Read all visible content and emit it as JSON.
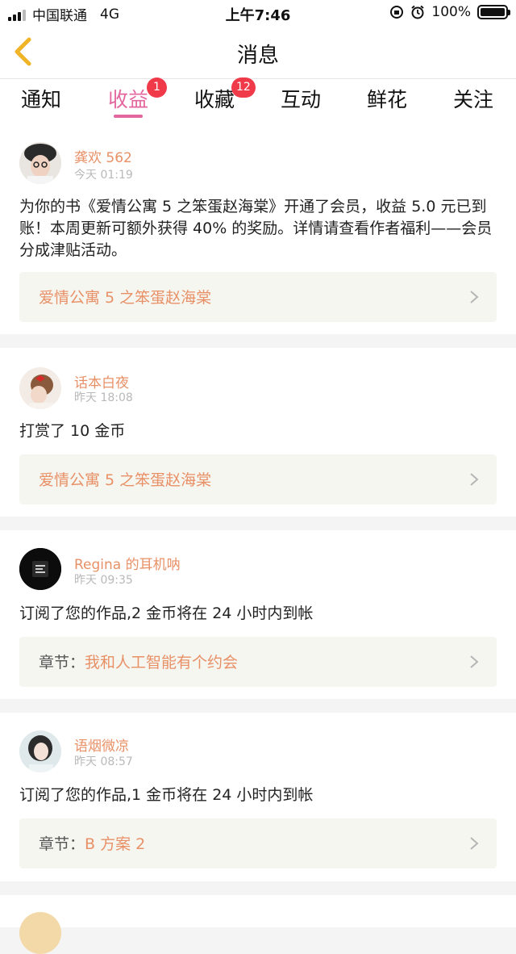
{
  "status_bar": {
    "carrier": "中国联通",
    "network": "4G",
    "time": "上午7:46",
    "battery": "100%"
  },
  "header": {
    "title": "消息"
  },
  "tabs": [
    {
      "label": "通知",
      "badge": ""
    },
    {
      "label": "收益",
      "badge": "1"
    },
    {
      "label": "收藏",
      "badge": "12"
    },
    {
      "label": "互动",
      "badge": ""
    },
    {
      "label": "鲜花",
      "badge": ""
    },
    {
      "label": "关注",
      "badge": ""
    }
  ],
  "active_tab": "收益",
  "colors": {
    "accent": "#e4669e",
    "username": "#e89066",
    "badge": "#f03a4a",
    "back_arrow": "#f0b428"
  },
  "messages": [
    {
      "user": "龚欢 562",
      "time": "今天 01:19",
      "text": "为你的书《爱情公寓 5 之笨蛋赵海棠》开通了会员，收益 5.0 元已到账！本周更新可额外获得 40% 的奖励。详情请查看作者福利——会员分成津贴活动。",
      "link_prefix": "",
      "link": "爱情公寓 5 之笨蛋赵海棠"
    },
    {
      "user": "话本白夜",
      "time": "昨天 18:08",
      "text": "打赏了 10 金币",
      "link_prefix": "",
      "link": "爱情公寓 5 之笨蛋赵海棠"
    },
    {
      "user": "Regina 的耳机呐",
      "time": "昨天 09:35",
      "text": "订阅了您的作品,2 金币将在 24 小时内到帐",
      "link_prefix": "章节：",
      "link": "我和人工智能有个约会"
    },
    {
      "user": "语烟微凉",
      "time": "昨天 08:57",
      "text": "订阅了您的作品,1 金币将在 24 小时内到帐",
      "link_prefix": "章节：",
      "link": "B 方案 2"
    }
  ]
}
